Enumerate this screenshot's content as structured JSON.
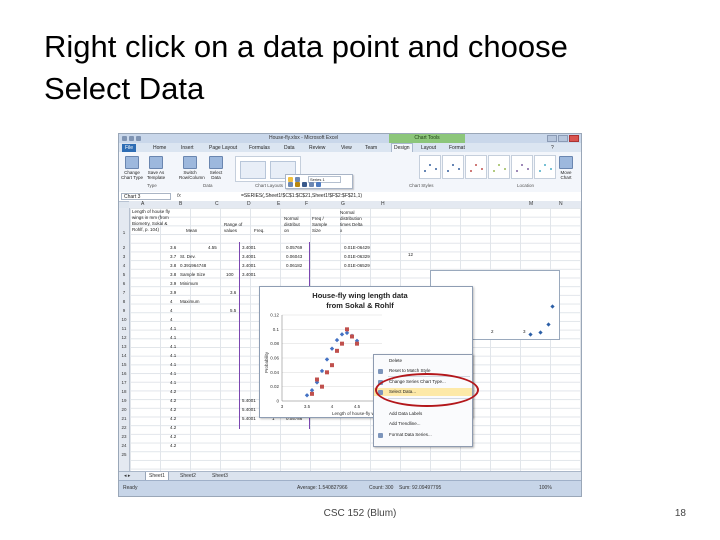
{
  "slide": {
    "title_line1": "Right click on a data point and choose",
    "title_line2": "Select Data",
    "footer": "CSC 152 (Blum)",
    "page_number": "18"
  },
  "window": {
    "title": "House-fly.xlsx - Microsoft Excel",
    "context_tab": "Chart Tools"
  },
  "tabs": [
    "File",
    "Home",
    "Insert",
    "Page Layout",
    "Formulas",
    "Data",
    "Review",
    "View",
    "Team",
    "Design",
    "Layout",
    "Format"
  ],
  "ribbon": {
    "buttons": [
      {
        "label": "Change Chart Type"
      },
      {
        "label": "Save As Template"
      },
      {
        "label": "Switch Row/Column"
      },
      {
        "label": "Select Data"
      },
      {
        "label": "Move Chart"
      }
    ],
    "groups": [
      "Type",
      "Data",
      "Chart Layouts",
      "Chart Styles",
      "Location"
    ]
  },
  "formula_bar": {
    "name_box": "Chart 3",
    "fx": "fx",
    "formula": "=SERIES(,Sheet1!$C$1:$C$21,Sheet1!$F$2:$F$21,1)"
  },
  "columns": [
    "A",
    "B",
    "C",
    "D",
    "E",
    "F",
    "G",
    "H",
    "M",
    "N"
  ],
  "rows": [
    "1",
    "2",
    "3",
    "4",
    "5",
    "6",
    "7",
    "8",
    "9",
    "10",
    "11",
    "12",
    "13",
    "14",
    "15",
    "16",
    "17",
    "18",
    "19",
    "20",
    "21",
    "22",
    "23",
    "24",
    "25"
  ],
  "cells": {
    "a1_l1": "Length of house fly",
    "a1_l2": "wings in mm (from",
    "a1_l3": "Biometry, Sokal &",
    "a1_l4": "Rohlf, p. 104)",
    "b1": "Mean",
    "c1_l1": "Range of",
    "c1_l2": "values",
    "d1": "Freq.",
    "e1_l1": "Normal",
    "e1_l2": "distribut",
    "e1_l3": "on",
    "f1_l1": "Freq /",
    "f1_l2": "Sample",
    "f1_l3": "Size",
    "g1_l1": "Normal",
    "g1_l2": "distribution",
    "g1_l3": "times Delta",
    "g1_l4": "x",
    "col_a": [
      "3.6",
      "3.7",
      "3.8",
      "3.8",
      "3.9",
      "3.9",
      "4",
      "4",
      "4",
      "4.1",
      "4.1",
      "4.1",
      "4.1",
      "4.1",
      "4.1",
      "4.1",
      "4.2",
      "4.2",
      "4.2",
      "4.2",
      "4.2",
      "4.2",
      "4.2"
    ],
    "b2": "4.55",
    "b3": "St. Dev.",
    "b4": "0.391964748",
    "b5": "Sample Size",
    "c5": "100",
    "b6": "Minimum",
    "c6": "3.6",
    "b7": "Maximum",
    "c7": "5.5",
    "col_c": [
      "3.4001",
      "3.4001",
      "3.4001",
      "3.4001"
    ],
    "bottom_c": [
      "5.4001",
      "5.4001",
      "5.4001"
    ],
    "bottom_d": [
      "2",
      "1",
      "1"
    ],
    "bottom_e": [
      "0.06716",
      "0.06182",
      "0.05786"
    ],
    "col_e": [
      "0.05769",
      "0.06043",
      "0.06182"
    ],
    "col_g": [
      "0.01E-06429",
      "0.01E-06329",
      "0.01E-06529"
    ],
    "m3": "12"
  },
  "chart": {
    "title_l1": "House-fly wing length data",
    "title_l2": "from Sokal & Rohlf",
    "ylabel": "Probability",
    "xlabel": "Length of house-fly wing"
  },
  "chart_data": {
    "type": "scatter",
    "title": "House-fly wing length data from Sokal & Rohlf",
    "xlabel": "Length of house-fly wing",
    "ylabel": "Probability",
    "x_ticks": [
      "3",
      "3.5",
      "4",
      "4.5"
    ],
    "y_ticks": [
      "0",
      "0.02",
      "0.04",
      "0.06",
      "0.08",
      "0.1",
      "0.12"
    ],
    "ylim": [
      0,
      0.12
    ],
    "xlim": [
      3,
      5
    ],
    "series": [
      {
        "name": "Series 1",
        "color": "#4472c4",
        "x": [
          3.5,
          3.6,
          3.7,
          3.8,
          3.9,
          4.0,
          4.1,
          4.2,
          4.3,
          4.4,
          4.5
        ],
        "y": [
          0.008,
          0.015,
          0.026,
          0.042,
          0.058,
          0.073,
          0.085,
          0.093,
          0.095,
          0.091,
          0.084
        ]
      },
      {
        "color": "#c0504d",
        "x": [
          3.6,
          3.7,
          3.8,
          3.9,
          4.0,
          4.1,
          4.2,
          4.3,
          4.4,
          4.5
        ],
        "y": [
          0.01,
          0.03,
          0.02,
          0.04,
          0.05,
          0.07,
          0.08,
          0.1,
          0.09,
          0.08
        ]
      }
    ]
  },
  "mini_toolbar": {
    "series_select": "Series 1"
  },
  "context_menu": {
    "items": [
      "Delete",
      "Reset to Match Style",
      "Change Series Chart Type...",
      "Select Data...",
      "Add Data Labels",
      "Add Trendline...",
      "Format Data Series..."
    ],
    "highlighted": "Select Data..."
  },
  "sheets": [
    "Sheet1",
    "Sheet2",
    "Sheet3"
  ],
  "status": {
    "ready": "Ready",
    "average": "Average: 1.540827966",
    "count": "Count: 300",
    "sum": "Sum: 92.09497795",
    "zoom": "100%"
  },
  "background_chart": {
    "y_tick": "12",
    "x_tick": "2",
    "x_tick2": "3"
  }
}
